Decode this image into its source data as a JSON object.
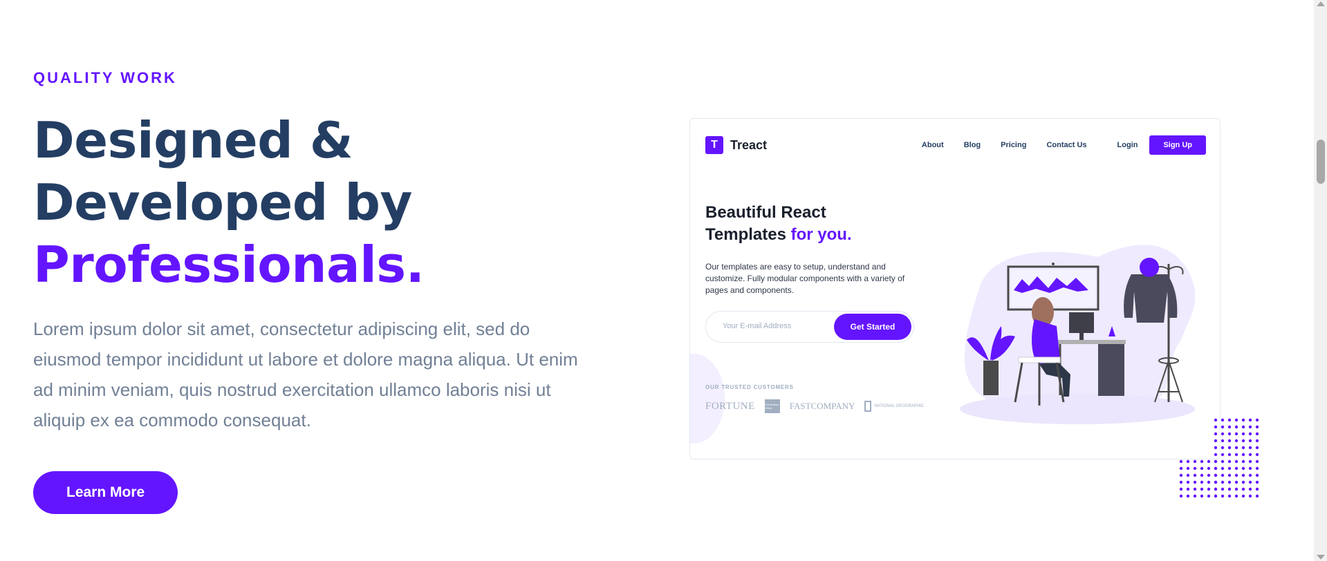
{
  "hero": {
    "eyebrow": "QUALITY WORK",
    "heading_line1": "Designed &",
    "heading_line2": "Developed by",
    "heading_accent": "Professionals.",
    "paragraph": "Lorem ipsum dolor sit amet, consectetur adipiscing elit, sed do eiusmod tempor incididunt ut labore et dolore magna aliqua. Ut enim ad minim veniam, quis nostrud exercitation ullamco laboris nisi ut aliquip ex ea commodo consequat.",
    "cta_label": "Learn More"
  },
  "preview": {
    "logo_letter": "T",
    "brand": "Treact",
    "nav": [
      "About",
      "Blog",
      "Pricing",
      "Contact Us"
    ],
    "login": "Login",
    "signup": "Sign Up",
    "title_line1": "Beautiful React",
    "title_line2": "Templates",
    "title_accent": "for you.",
    "description": "Our templates are easy to setup, understand and customize. Fully modular components with a variety of pages and components.",
    "email_placeholder": "Your E-mail Address",
    "get_started": "Get Started",
    "customers_label": "OUR TRUSTED CUSTOMERS",
    "customer_logos": [
      "FORTUNE",
      "The Boston Globe",
      "FASTCOMPANY",
      "NATIONAL GEOGRAPHIC"
    ]
  },
  "colors": {
    "primary": "#6415ff",
    "heading": "#243e63",
    "text": "#718096"
  }
}
